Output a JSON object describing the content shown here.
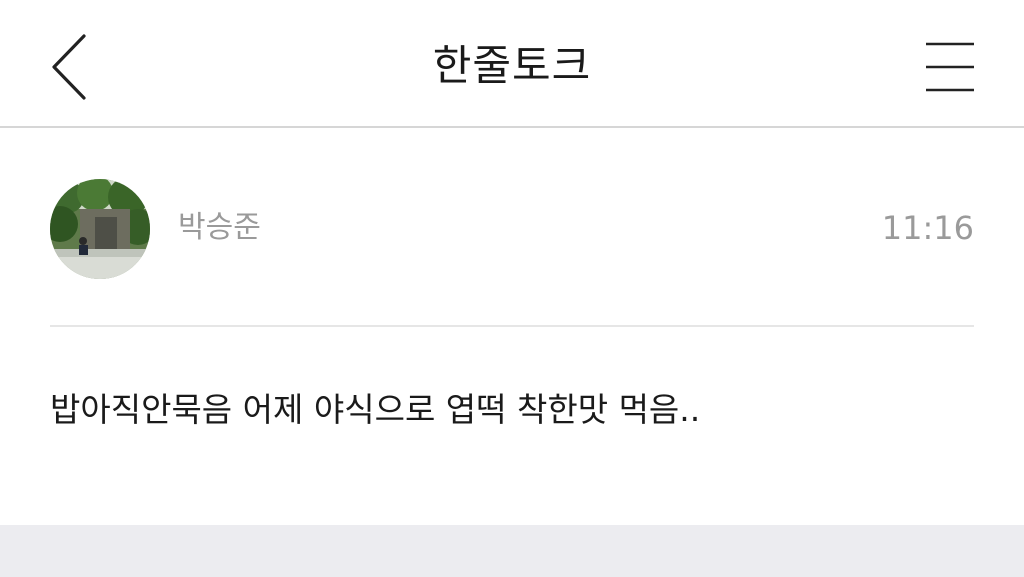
{
  "header": {
    "title": "한줄토크",
    "back_icon": "chevron-left-icon",
    "menu_icon": "hamburger-menu-icon"
  },
  "post": {
    "author": "박승준",
    "time": "11:16",
    "content": "밥아직안묵음 어제 야식으로 엽떡 착한맛 먹음.."
  },
  "colors": {
    "background": "#ffffff",
    "text_primary": "#1a1a1a",
    "text_secondary": "#9a9a9a",
    "divider": "#e6e6e6",
    "bottom_band": "#ececf0"
  }
}
